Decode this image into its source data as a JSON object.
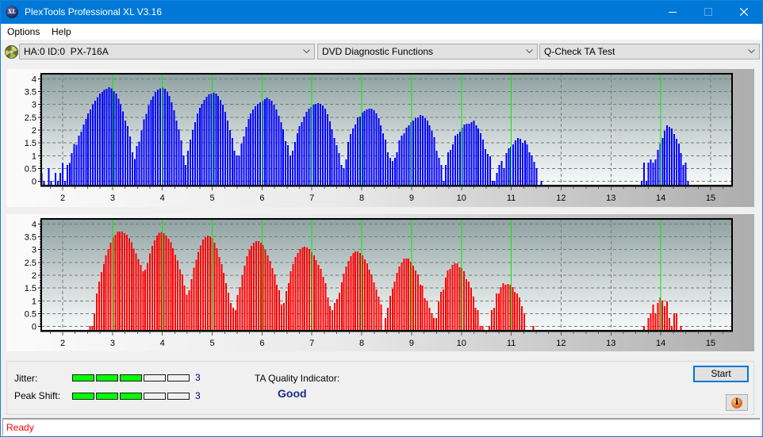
{
  "window": {
    "title": "PlexTools Professional XL V3.16",
    "logo_text": "XL"
  },
  "menu": {
    "items": [
      {
        "label": "Options"
      },
      {
        "label": "Help"
      }
    ]
  },
  "toolbar": {
    "drive_select": {
      "value": "HA:0 ID:0  PX-716A"
    },
    "function_select": {
      "value": "DVD Diagnostic Functions"
    },
    "test_select": {
      "value": "Q-Check TA Test"
    }
  },
  "colors": {
    "accent": "#0078d7",
    "indicator_on": "#00ff00",
    "status_text": "#ff0000",
    "quality_text": "#1c2d8a",
    "value_text": "#000080",
    "highlight_line": "#00ee00"
  },
  "chart_data": [
    {
      "type": "bar",
      "title": "",
      "xlabel": "",
      "ylabel": "",
      "xlim": [
        1.57,
        15.43
      ],
      "ylim": [
        -0.165,
        4.195
      ],
      "grid": true,
      "xticks": [
        2,
        3,
        4,
        5,
        6,
        7,
        8,
        9,
        10,
        11,
        12,
        13,
        14,
        15
      ],
      "yticks": [
        4,
        3.5,
        3,
        2.5,
        2,
        1.5,
        1,
        0.5,
        0
      ],
      "highlight_x": [
        3,
        4,
        5,
        6,
        7,
        8,
        9,
        10,
        11,
        14
      ],
      "bar_color": "#0000ff",
      "groups": [
        {
          "x_start": 1.58,
          "x_step": 0.0466,
          "values": [
            0.33,
            0.02,
            null,
            0.52,
            0.02,
            null,
            0.33,
            0.02,
            0.33,
            0.72,
            0.02,
            0.64,
            0.72,
            1.1,
            1.46,
            1.42,
            1.78,
            1.94,
            2.22,
            2.43,
            2.65,
            2.8,
            3.0,
            3.14,
            3.28,
            3.42,
            3.48,
            3.58,
            3.6,
            3.67,
            3.63,
            3.52,
            3.42,
            3.22,
            3.0,
            2.73,
            2.37,
            2.16,
            1.75,
            1.13,
            0.87,
            1.38,
            1.55,
            1.98,
            2.41,
            2.63,
            2.97,
            3.18,
            3.32,
            3.48,
            3.58,
            3.63,
            3.65,
            3.61,
            3.5,
            3.33,
            3.08,
            2.78,
            2.37,
            2.03,
            1.6,
            1.01,
            0.64,
            1.2,
            1.63,
            2.0,
            2.31,
            2.65,
            2.87,
            3.02,
            3.18,
            3.3,
            3.39,
            3.42,
            3.45,
            3.42,
            3.33,
            3.18,
            2.99,
            2.71,
            2.37,
            2.0,
            1.69,
            1.2,
            1.01,
            1.01,
            1.47,
            1.75,
            2.12,
            2.43,
            2.65,
            2.8,
            2.93,
            3.02,
            3.08,
            3.14,
            3.21,
            3.27,
            3.21,
            3.14,
            2.99,
            2.8,
            2.56,
            2.31,
            2.03,
            1.57,
            1.41,
            1.01,
            1.2,
            1.54,
            1.88,
            2.15,
            2.31,
            2.53,
            2.71,
            2.84,
            2.9,
            2.99,
            3.02,
            3.05,
            3.02,
            2.96,
            2.84,
            2.62,
            2.34,
            2.03,
            1.69,
            1.41,
            1.1,
            0.64,
            0.52,
            0.86,
            1.54,
            1.85,
            2.06,
            2.22,
            2.49,
            2.53,
            2.68,
            2.74,
            2.8,
            2.84,
            2.84,
            2.77,
            2.65,
            2.46,
            2.19,
            1.88,
            1.63,
            1.13,
            0.92,
            0.79,
            0.92,
            1.13,
            1.6,
            1.78,
            1.88,
            2.09,
            2.19,
            2.31,
            2.37,
            2.46,
            2.49,
            2.59,
            2.56,
            2.46,
            2.37,
            2.19,
            1.97,
            1.72,
            1.2,
            0.92,
            0.64,
            0.02,
            0.64,
            1.13,
            1.23,
            1.44,
            1.78,
            1.85,
            1.94,
            2.09,
            2.22,
            2.25,
            2.25,
            2.31,
            2.37,
            2.19,
            2.06,
            1.88,
            1.63,
            1.26,
            1.07,
            0.98,
            0.02,
            0.02,
            0.33,
            0.64,
            0.79,
            0.52,
            1.1,
            1.29,
            1.35,
            1.44,
            1.6,
            1.69,
            1.66,
            1.5,
            1.6,
            1.44,
            1.13,
            1.01,
            0.76,
            0.52,
            null,
            0.02
          ]
        },
        {
          "x_start": 13.615,
          "x_step": 0.0466,
          "values": [
            0.02,
            0.73,
            0.02,
            0.73,
            0.86,
            0.73,
            0.86,
            1.23,
            1.47,
            1.69,
            1.97,
            2.19,
            2.12,
            2.06,
            1.85,
            1.66,
            1.47,
            1.1,
            0.64,
            0.73,
            0.02
          ]
        }
      ]
    },
    {
      "type": "bar",
      "title": "",
      "xlabel": "",
      "ylabel": "",
      "xlim": [
        1.57,
        15.43
      ],
      "ylim": [
        -0.165,
        4.195
      ],
      "grid": true,
      "xticks": [
        2,
        3,
        4,
        5,
        6,
        7,
        8,
        9,
        10,
        11,
        12,
        13,
        14,
        15
      ],
      "yticks": [
        4,
        3.5,
        3,
        2.5,
        2,
        1.5,
        1,
        0.5,
        0
      ],
      "highlight_x": [
        3,
        4,
        5,
        6,
        7,
        8,
        9,
        10,
        11,
        14
      ],
      "bar_color": "#ff0000",
      "groups": [
        {
          "x_start": 2.546,
          "x_step": 0.04634,
          "values": [
            0.02,
            0.02,
            0.52,
            1.29,
            1.75,
            2.12,
            2.43,
            2.77,
            3.02,
            3.27,
            3.47,
            3.58,
            3.7,
            3.7,
            3.7,
            3.64,
            3.58,
            3.43,
            3.28,
            3.03,
            2.85,
            2.63,
            2.4,
            2.15,
            2.22,
            2.46,
            2.85,
            3.15,
            3.36,
            3.55,
            3.65,
            3.68,
            3.64,
            3.54,
            3.42,
            3.28,
            3.05,
            2.81,
            2.57,
            2.23,
            2.03,
            1.6,
            1.24,
            1.41,
            1.85,
            2.29,
            2.6,
            2.91,
            3.16,
            3.39,
            3.48,
            3.55,
            3.52,
            3.43,
            3.27,
            3.05,
            2.71,
            2.43,
            2.09,
            1.69,
            1.32,
            0.92,
            0.73,
            0.64,
            1.23,
            1.54,
            2.0,
            2.37,
            2.74,
            2.99,
            3.14,
            3.27,
            3.33,
            3.33,
            3.27,
            3.18,
            2.99,
            2.77,
            2.56,
            2.28,
            2.03,
            1.63,
            1.41,
            0.86,
            0.92,
            1.38,
            1.69,
            2.15,
            2.43,
            2.71,
            2.87,
            3.02,
            3.08,
            3.11,
            3.08,
            3.02,
            2.9,
            2.77,
            2.59,
            2.4,
            2.25,
            1.94,
            1.69,
            1.13,
            0.79,
            0.64,
            0.92,
            1.07,
            1.32,
            1.72,
            2.06,
            2.34,
            2.56,
            2.74,
            2.87,
            2.93,
            2.93,
            2.87,
            2.77,
            2.62,
            2.46,
            2.22,
            2.03,
            1.72,
            1.44,
            1.16,
            0.86,
            null,
            0.33,
            0.73,
            1.2,
            1.47,
            1.75,
            2.09,
            2.34,
            2.49,
            2.65,
            2.65,
            2.65,
            2.53,
            2.37,
            2.19,
            2.03,
            1.63,
            1.6,
            1.1,
            1.01,
            0.73,
            0.52,
            0.33,
            0.33,
            0.98,
            1.35,
            1.44,
            1.91,
            2.19,
            2.25,
            2.4,
            2.46,
            2.46,
            2.31,
            2.28,
            2.15,
            1.85,
            1.75,
            1.5,
            1.16,
            0.73,
            0.64,
            0.02,
            0.02,
            null,
            null,
            0.02,
            0.64,
            0.73,
            1.29,
            1.29,
            1.54,
            1.69,
            1.63,
            1.66,
            1.63,
            1.54,
            1.35,
            1.29,
            1.13,
            0.79,
            0.52,
            null,
            null,
            null,
            0.02
          ]
        },
        {
          "x_start": 13.66,
          "x_step": 0.0466,
          "values": [
            0.02,
            null,
            0.33,
            0.52,
            0.86,
            0.52,
            0.92,
            1.13,
            1.01,
            0.79,
            0.98,
            0.33,
            0.02,
            0.52,
            0.52,
            null,
            0.02
          ]
        }
      ]
    }
  ],
  "results": {
    "jitter": {
      "label": "Jitter:",
      "level": 3,
      "max": 5,
      "value_text": "3"
    },
    "peak_shift": {
      "label": "Peak Shift:",
      "level": 3,
      "max": 5,
      "value_text": "3"
    },
    "ta_quality": {
      "label": "TA Quality Indicator:",
      "value": "Good"
    }
  },
  "buttons": {
    "start": "Start"
  },
  "status": {
    "text": "Ready"
  }
}
